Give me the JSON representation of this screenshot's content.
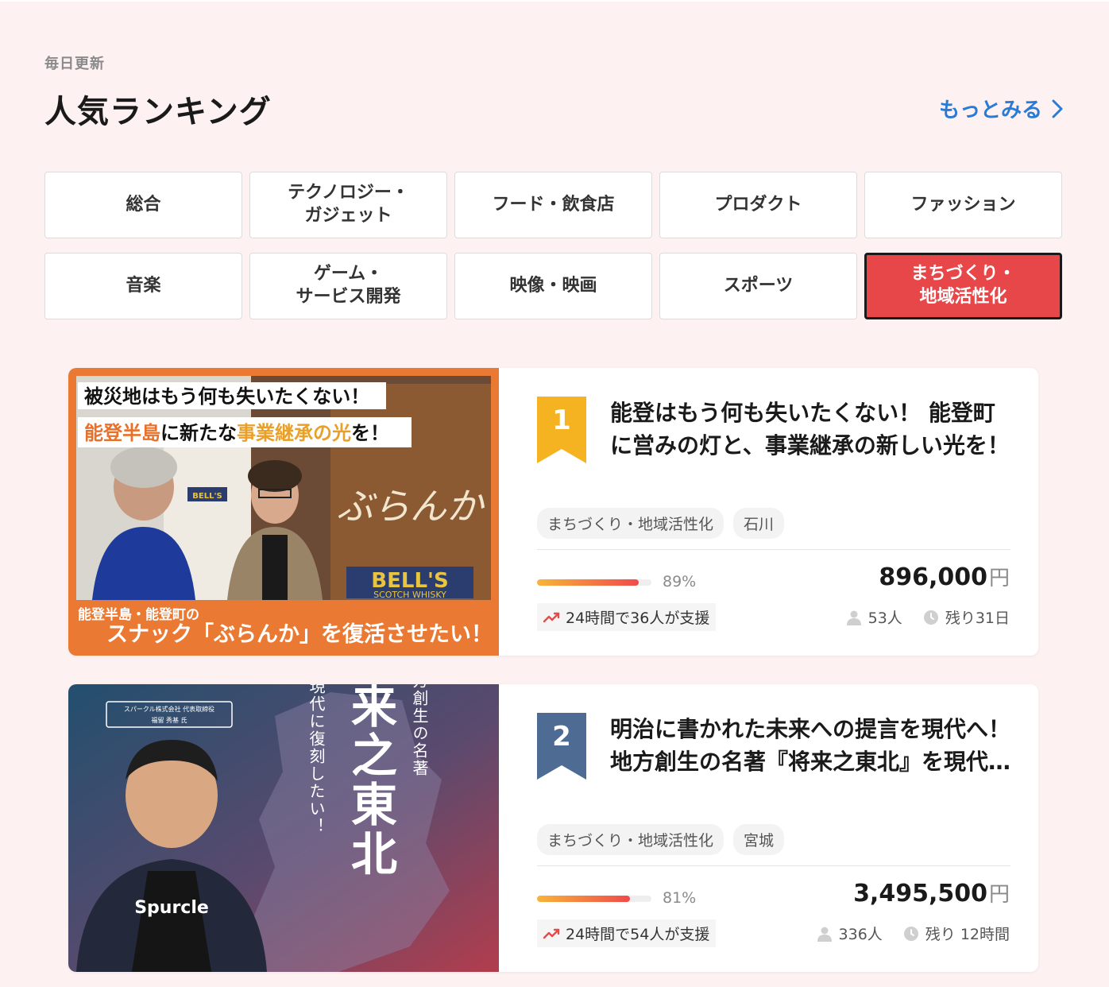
{
  "header": {
    "subtitle": "毎日更新",
    "title": "人気ランキング",
    "more_label": "もっとみる"
  },
  "categories": [
    {
      "label": "総合",
      "active": false
    },
    {
      "label": "テクノロジー・\nガジェット",
      "active": false
    },
    {
      "label": "フード・飲食店",
      "active": false
    },
    {
      "label": "プロダクト",
      "active": false
    },
    {
      "label": "ファッション",
      "active": false
    },
    {
      "label": "音楽",
      "active": false
    },
    {
      "label": "ゲーム・\nサービス開発",
      "active": false
    },
    {
      "label": "映像・映画",
      "active": false
    },
    {
      "label": "スポーツ",
      "active": false
    },
    {
      "label": "まちづくり・\n地域活性化",
      "active": true
    }
  ],
  "projects": [
    {
      "rank": "1",
      "rank_color": "#f5b321",
      "title": "能登はもう何も失いたくない！ 能登町に営みの灯と、事業継承の新しい光を！",
      "tags": [
        "まちづくり・地域活性化",
        "石川"
      ],
      "progress_percent": 89,
      "progress_label": "89%",
      "amount": "896,000",
      "currency": "円",
      "trend": "24時間で36人が支援",
      "supporters": "53人",
      "remaining": "残り31日",
      "thumb": {
        "line1": "被災地はもう何も失いたくない！",
        "line2_a": "能登半島",
        "line2_b": "に新たな",
        "line2_c": "事業継承の光",
        "line2_d": "を！",
        "sub": "能登半島・能登町の",
        "main": "スナック「ぶらんか」を復活させたい！",
        "sign": "ぶらんか",
        "bells": "BELL'S",
        "bells_sub": "SCOTCH WHISKY",
        "bells_small": "BELL'S"
      }
    },
    {
      "rank": "2",
      "rank_color": "#4e6b94",
      "title": "明治に書かれた未来への提言を現代へ！地方創生の名著『将来之東北』を現代に復刻したい！",
      "tags": [
        "まちづくり・地域活性化",
        "宮城"
      ],
      "progress_percent": 81,
      "progress_label": "81%",
      "amount": "3,495,500",
      "currency": "円",
      "trend": "24時間で54人が支援",
      "supporters": "336人",
      "remaining": "残り 12時間",
      "thumb": {
        "company_line1": "スパークル株式会社 代表取締役",
        "company_line2": "福留 秀基 氏",
        "big_title": "将来之東北",
        "side1": "地方創生の名著",
        "side2": "を現代に復刻したい！",
        "shirt": "Spurcle"
      }
    }
  ]
}
